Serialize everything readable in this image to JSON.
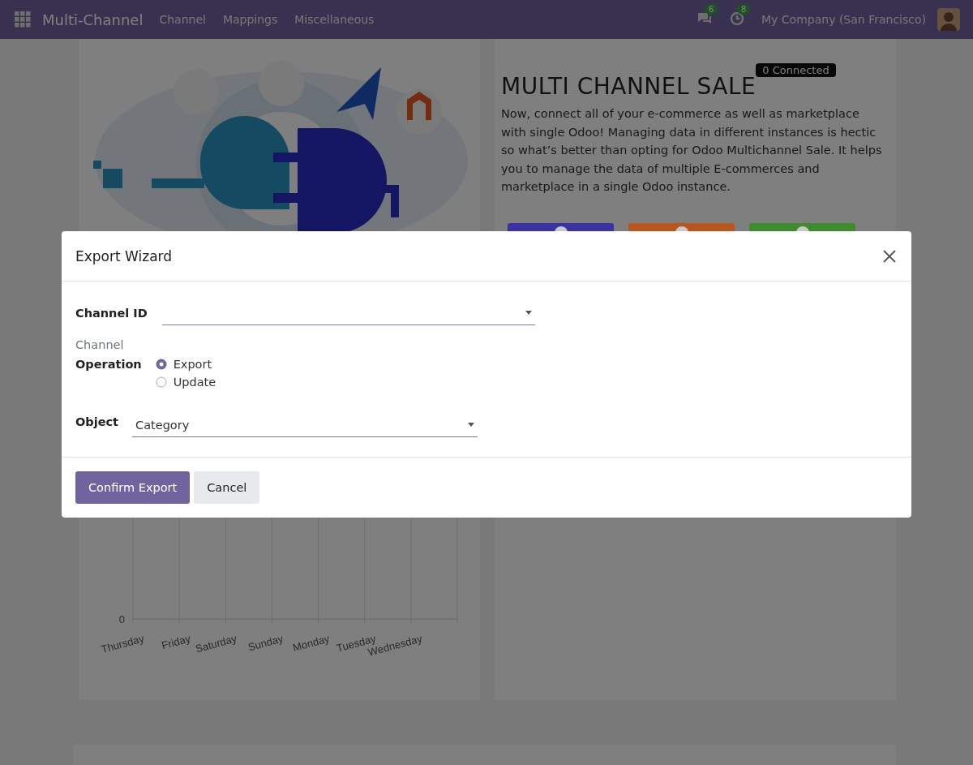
{
  "navbar": {
    "app_name": "Multi-Channel",
    "menu": [
      "Channel",
      "Mappings",
      "Miscellaneous"
    ],
    "messages_badge": "6",
    "activities_badge": "8",
    "company": "My Company (San Francisco)"
  },
  "hero": {
    "title": "MULTI CHANNEL SALE",
    "status_badge": "0 Connected",
    "description": "Now, connect all of your e-commerce as well as marketplace with single Odoo! Managing data in different instances is hectic so what’s better than opting for Odoo Multichannel Sale. It helps you to manage the data of multiple E-commerces and marketplace in a single Odoo instance.",
    "action_buttons": [
      {
        "color": "#3a31a6"
      },
      {
        "color": "#b8561d"
      },
      {
        "color": "#3e8c2b"
      }
    ]
  },
  "chart": {
    "y_tick": "0",
    "x_labels": [
      "Thursday",
      "Friday",
      "Saturday",
      "Sunday",
      "Monday",
      "Tuesday",
      "Wednesday"
    ]
  },
  "modal": {
    "title": "Export Wizard",
    "channel_id": {
      "label": "Channel ID"
    },
    "channel_label": "Channel",
    "operation": {
      "label": "Operation",
      "options": [
        {
          "label": "Export",
          "selected": true
        },
        {
          "label": "Update",
          "selected": false
        }
      ]
    },
    "object": {
      "label": "Object",
      "value": "Category"
    },
    "buttons": [
      {
        "label": "Confirm Export",
        "kind": "primary"
      },
      {
        "label": "Cancel",
        "kind": "secondary"
      }
    ]
  }
}
